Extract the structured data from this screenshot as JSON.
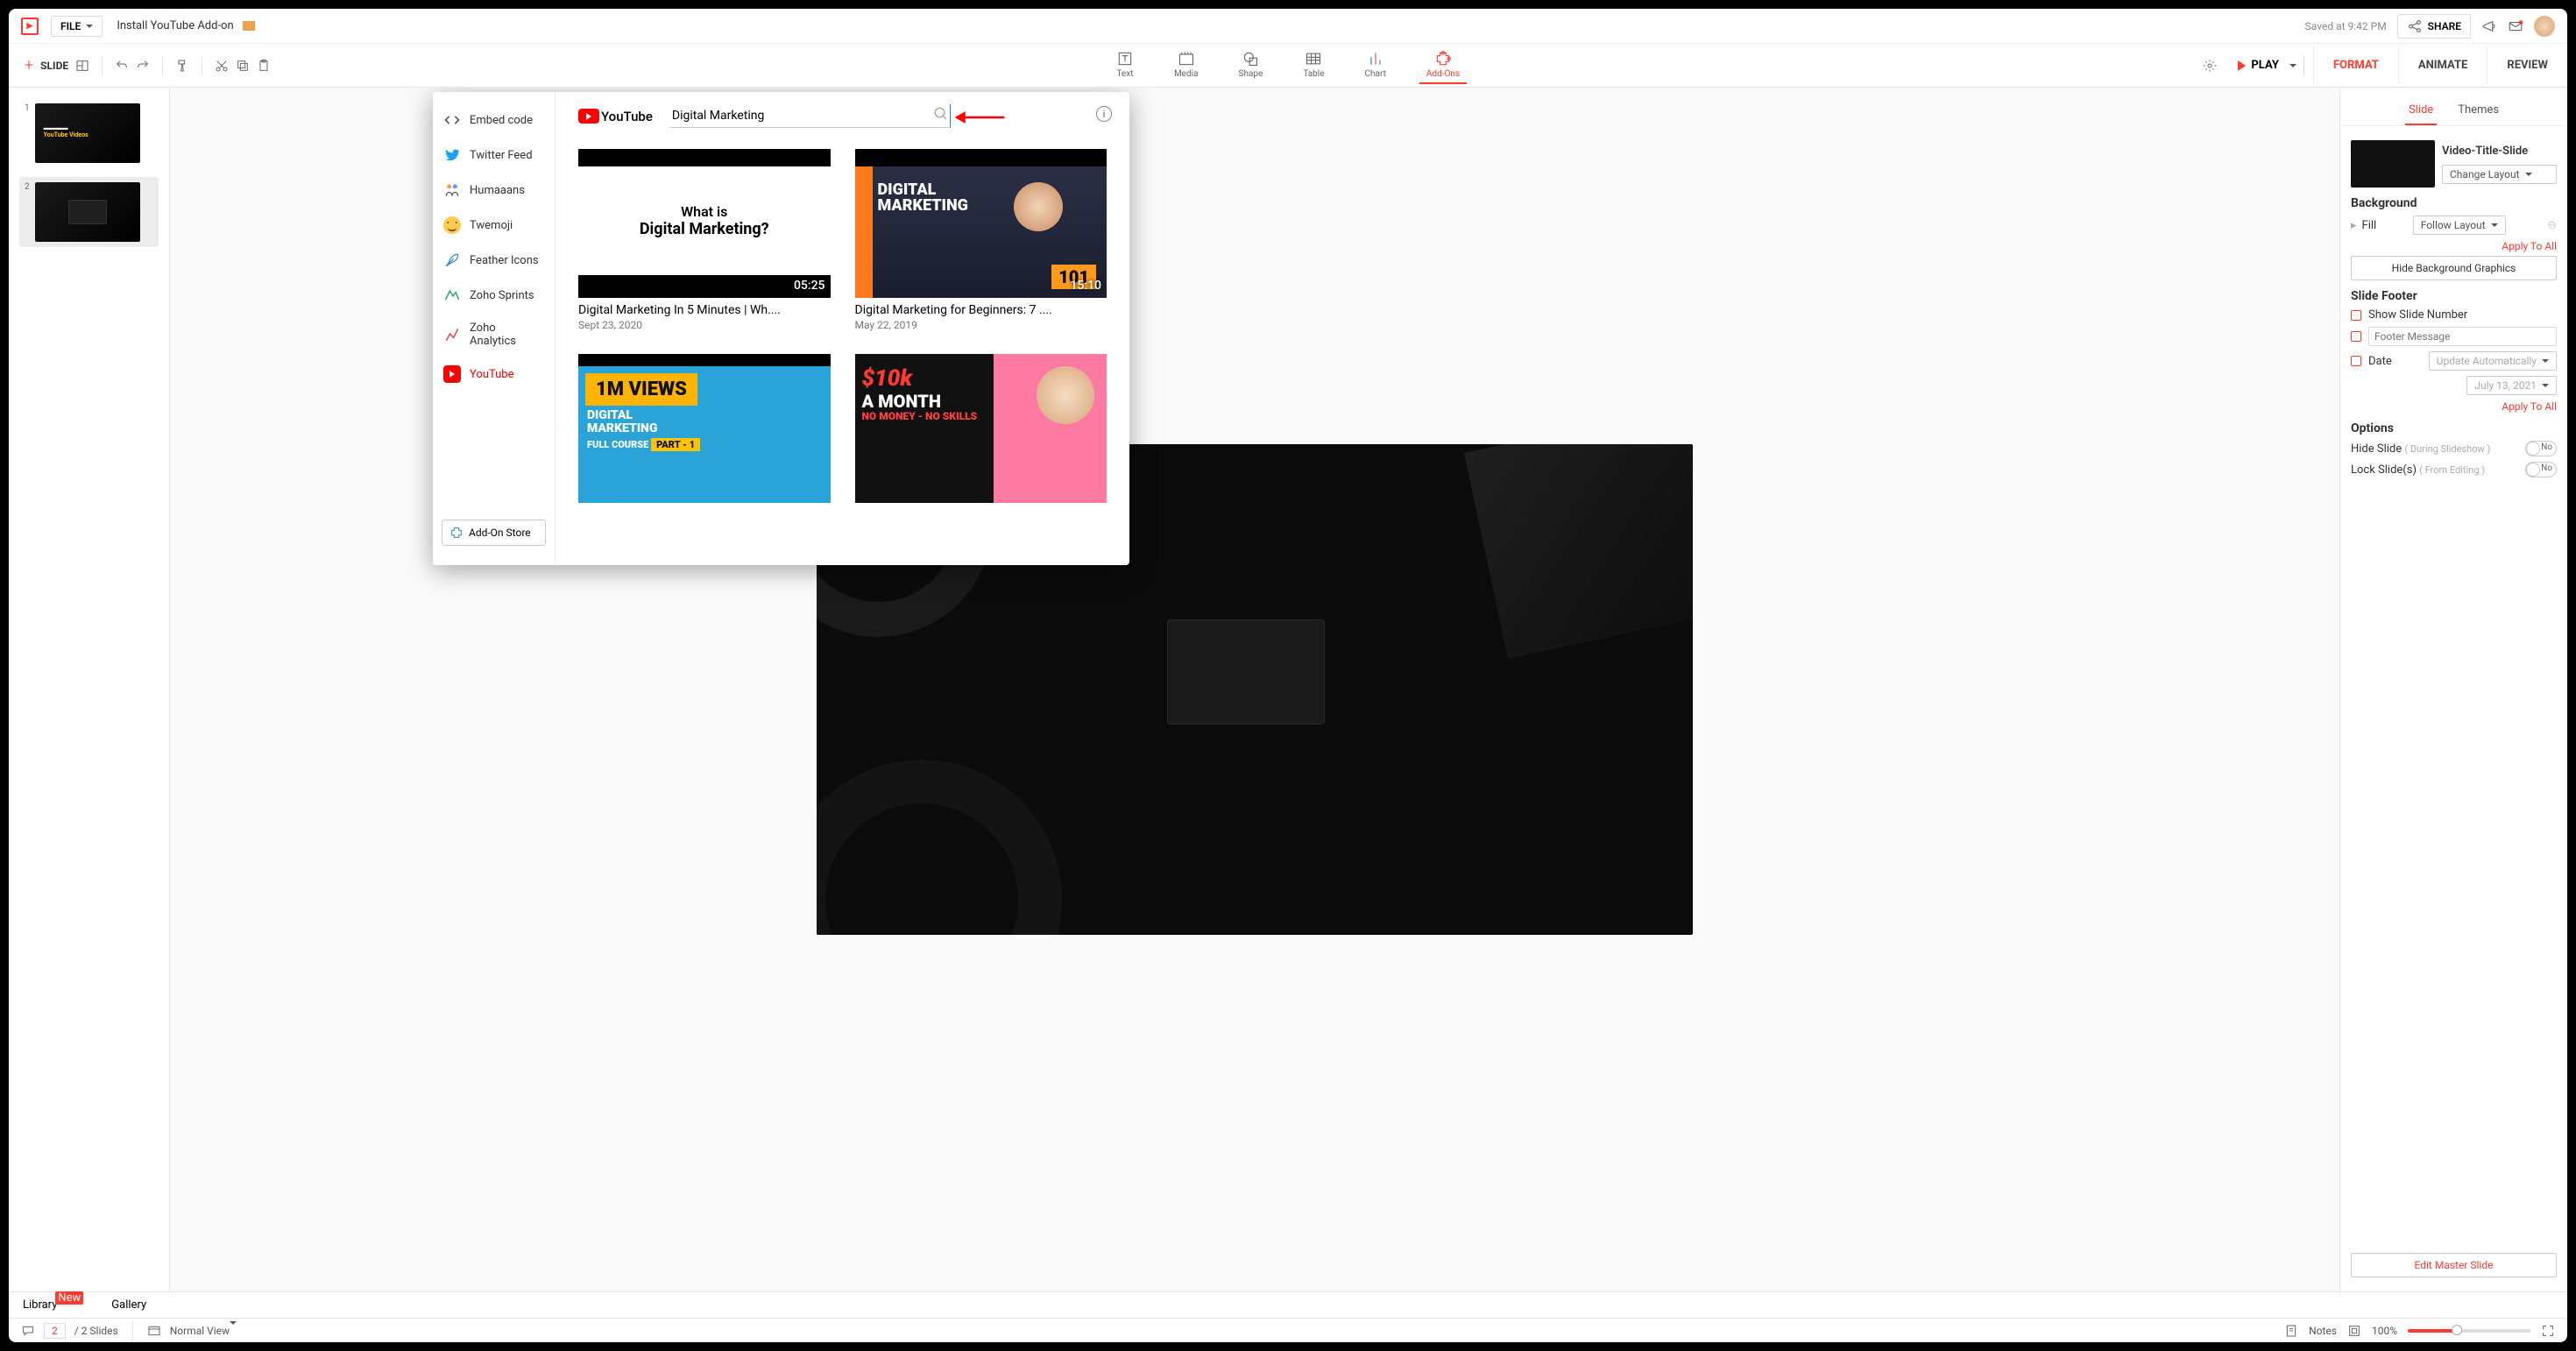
{
  "top": {
    "file_label": "FILE",
    "doc_title": "Install YouTube Add-on",
    "saved_at": "Saved at 9:42 PM",
    "share_label": "SHARE"
  },
  "toolbar": {
    "new_slide": "SLIDE",
    "center": [
      "Text",
      "Media",
      "Shape",
      "Table",
      "Chart",
      "Add-Ons"
    ],
    "play": "PLAY",
    "right_tabs": [
      "FORMAT",
      "ANIMATE",
      "REVIEW"
    ]
  },
  "slides": {
    "list": [
      "1",
      "2"
    ]
  },
  "right_panel": {
    "tabs": [
      "Slide",
      "Themes"
    ],
    "layout_title": "Video-Title-Slide",
    "change_layout": "Change Layout",
    "background": "Background",
    "fill": "Fill",
    "follow_layout": "Follow Layout",
    "apply_all": "Apply To All",
    "hide_bg_graphics": "Hide Background Graphics",
    "slide_footer": "Slide Footer",
    "show_slide_number": "Show Slide Number",
    "footer_placeholder": "Footer Message",
    "date_label": "Date",
    "date_mode": "Update Automatically",
    "date_value": "July 13, 2021",
    "apply_all2": "Apply To All",
    "options": "Options",
    "hide_slide": "Hide Slide",
    "hide_slide_hint": "( During Slideshow )",
    "lock_slide": "Lock Slide(s)",
    "lock_slide_hint": "( From Editing )",
    "toggle_no": "No",
    "edit_master": "Edit Master Slide"
  },
  "library": {
    "library": "Library",
    "new": "New",
    "gallery": "Gallery"
  },
  "status": {
    "current": "2",
    "total": "2 Slides",
    "view": "Normal View",
    "notes": "Notes",
    "zoom": "100%"
  },
  "modal": {
    "side_items": [
      "Embed code",
      "Twitter Feed",
      "Humaaans",
      "Twemoji",
      "Feather Icons",
      "Zoho Sprints",
      "Zoho Analytics",
      "YouTube"
    ],
    "addon_store": "Add-On Store",
    "youtube_brand": "YouTube",
    "search_value": "Digital Marketing",
    "results": [
      {
        "title": "Digital Marketing In 5 Minutes | Wh....",
        "date": "Sept 23, 2020",
        "duration": "05:25",
        "t": {
          "a": "What is",
          "b": "Digital Marketing?"
        }
      },
      {
        "title": "Digital Marketing for Beginners: 7 ....",
        "date": "May 22, 2019",
        "duration": "15:10",
        "t": {
          "a": "DIGITAL",
          "b": "MARKETING",
          "c": "101"
        }
      },
      {
        "title": "",
        "date": "",
        "duration": "",
        "t": {
          "badge": "1M VIEWS",
          "a": "DIGITAL",
          "b": "MARKETING",
          "c": "FULL COURSE",
          "d": "PART - 1"
        }
      },
      {
        "title": "",
        "date": "",
        "duration": "",
        "t": {
          "a": "$10k",
          "b": "A MONTH",
          "c": "NO MONEY - NO SKILLS"
        }
      }
    ]
  }
}
